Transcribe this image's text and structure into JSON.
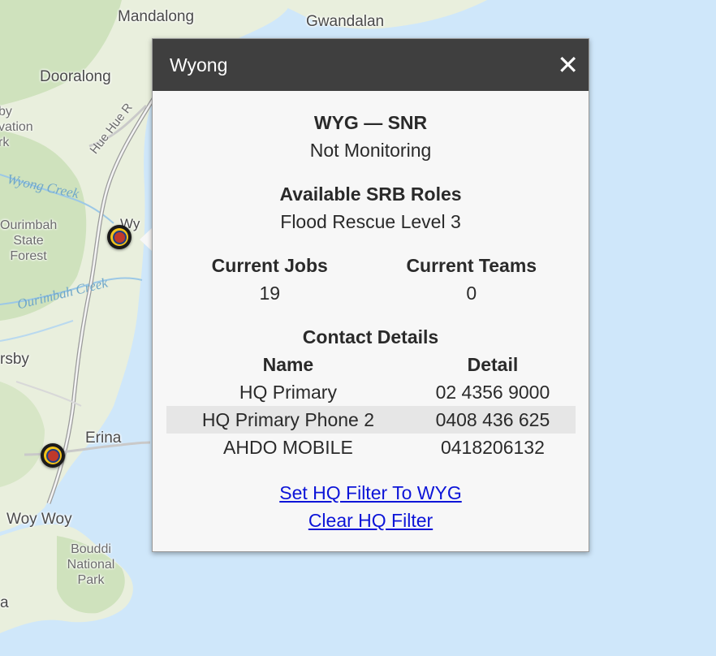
{
  "map": {
    "places": [
      "Mandalong",
      "Gwandalan",
      "Dooralong",
      "by\nvation\nrk",
      "Ourimbah\nState\nForest",
      "Wy",
      "rsby",
      "Erina",
      "Woy Woy",
      "Bouddi\nNational\nPark",
      "a"
    ],
    "water_labels": [
      "Wyong Creek",
      "Ourimbah Creek"
    ],
    "road_labels": [
      "Hue Hue R"
    ],
    "markers": [
      "Wyong HQ marker",
      "Erina HQ marker"
    ],
    "colors": {
      "land": "#e9efdd",
      "water": "#cfe7fa",
      "forest": "#cfe2bd",
      "road": "#aaaaaa"
    }
  },
  "popup": {
    "title": "Wyong",
    "close_icon": "close-icon",
    "unit_code": "WYG — SNR",
    "unit_status": "Not Monitoring",
    "roles_heading": "Available SRB Roles",
    "roles_value": "Flood Rescue Level 3",
    "jobs_heading": "Current Jobs",
    "jobs_value": "19",
    "teams_heading": "Current Teams",
    "teams_value": "0",
    "contact_heading": "Contact Details",
    "contact_columns": [
      "Name",
      "Detail"
    ],
    "contacts": [
      {
        "name": "HQ Primary",
        "detail": "02 4356 9000"
      },
      {
        "name": "HQ Primary Phone 2",
        "detail": "0408 436 625"
      },
      {
        "name": "AHDO MOBILE",
        "detail": "0418206132"
      }
    ],
    "link_set_filter": "Set HQ Filter To WYG",
    "link_clear_filter": "Clear HQ Filter",
    "colors": {
      "header": "#3f3f3f",
      "body": "#f7f7f7",
      "link": "#0c14d8",
      "row_alt": "#e6e6e6"
    }
  }
}
